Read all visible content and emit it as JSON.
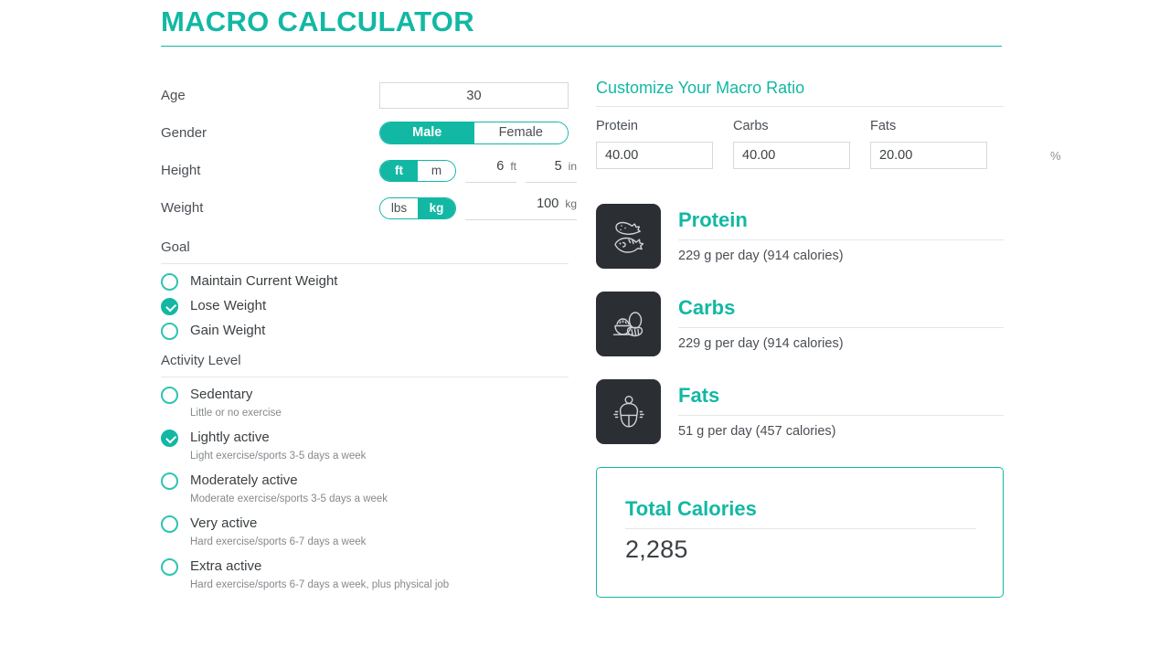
{
  "header": {
    "title": "MACRO CALCULATOR",
    "accent_color": "#12b8a4"
  },
  "form": {
    "age": {
      "label": "Age",
      "value": "30"
    },
    "gender": {
      "label": "Gender",
      "options": [
        "Male",
        "Female"
      ],
      "selected": "Male"
    },
    "height": {
      "label": "Height",
      "unit_options": [
        "ft",
        "m"
      ],
      "unit_selected": "ft",
      "feet_value": "6",
      "feet_unit": "ft",
      "inches_value": "5",
      "inches_unit": "in"
    },
    "weight": {
      "label": "Weight",
      "unit_options": [
        "lbs",
        "kg"
      ],
      "unit_selected": "kg",
      "value": "100",
      "unit": "kg"
    }
  },
  "goal": {
    "title": "Goal",
    "options": [
      {
        "label": "Maintain Current Weight",
        "selected": false
      },
      {
        "label": "Lose Weight",
        "selected": true
      },
      {
        "label": "Gain Weight",
        "selected": false
      }
    ]
  },
  "activity": {
    "title": "Activity Level",
    "options": [
      {
        "label": "Sedentary",
        "desc": "Little or no exercise",
        "selected": false
      },
      {
        "label": "Lightly active",
        "desc": "Light exercise/sports 3-5 days a week",
        "selected": true
      },
      {
        "label": "Moderately active",
        "desc": "Moderate exercise/sports 3-5 days a week",
        "selected": false
      },
      {
        "label": "Very active",
        "desc": "Hard exercise/sports 6-7 days a week",
        "selected": false
      },
      {
        "label": "Extra active",
        "desc": "Hard exercise/sports 6-7 days a week, plus physical job",
        "selected": false
      }
    ]
  },
  "macro_ratio": {
    "title": "Customize Your Macro Ratio",
    "fields": [
      {
        "label": "Protein",
        "value": "40.00",
        "suffix": "%"
      },
      {
        "label": "Carbs",
        "value": "40.00",
        "suffix": "%"
      },
      {
        "label": "Fats",
        "value": "20.00",
        "suffix": "%"
      }
    ]
  },
  "results": {
    "cards": [
      {
        "name": "Protein",
        "icon": "chicken-fish-icon",
        "amount": "229 g per day (914 calories)"
      },
      {
        "name": "Carbs",
        "icon": "rice-bowl-bread-icon",
        "amount": "229 g per day (914 calories)"
      },
      {
        "name": "Fats",
        "icon": "body-figure-icon",
        "amount": "51 g per day (457 calories)"
      }
    ],
    "total": {
      "title": "Total Calories",
      "value": "2,285"
    }
  }
}
